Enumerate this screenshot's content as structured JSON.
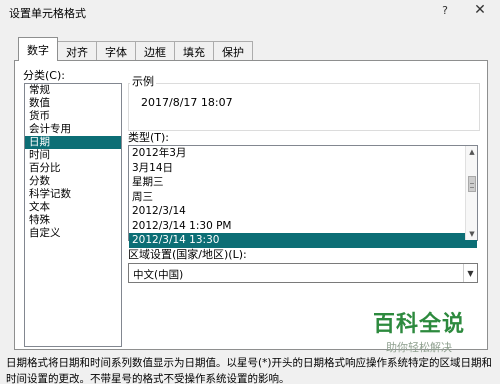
{
  "window": {
    "title": "设置单元格格式",
    "help_label": "?",
    "close_label": "✕"
  },
  "tabs": [
    {
      "label": "数字",
      "active": true
    },
    {
      "label": "对齐",
      "active": false
    },
    {
      "label": "字体",
      "active": false
    },
    {
      "label": "边框",
      "active": false
    },
    {
      "label": "填充",
      "active": false
    },
    {
      "label": "保护",
      "active": false
    }
  ],
  "category": {
    "label": "分类(C):",
    "items": [
      "常规",
      "数值",
      "货币",
      "会计专用",
      "日期",
      "时间",
      "百分比",
      "分数",
      "科学记数",
      "文本",
      "特殊",
      "自定义"
    ],
    "selected_index": 4
  },
  "sample": {
    "label": "示例",
    "value": "2017/8/17 18:07"
  },
  "type": {
    "label": "类型(T):",
    "items": [
      "2012年3月",
      "3月14日",
      "星期三",
      "周三",
      "2012/3/14",
      "2012/3/14 1:30 PM",
      "2012/3/14 13:30"
    ],
    "selected_index": 6
  },
  "region": {
    "label": "区域设置(国家/地区)(L):",
    "value": "中文(中国)"
  },
  "watermark": {
    "main": "百科全说",
    "sub": "助你轻松解决"
  },
  "description": "日期格式将日期和时间系列数值显示为日期值。以星号(*)开头的日期格式响应操作系统特定的区域日期和时间设置的更改。不带星号的格式不受操作系统设置的影响。",
  "colors": {
    "selection": "#0c6e75",
    "watermark": "#2d8a3e"
  }
}
